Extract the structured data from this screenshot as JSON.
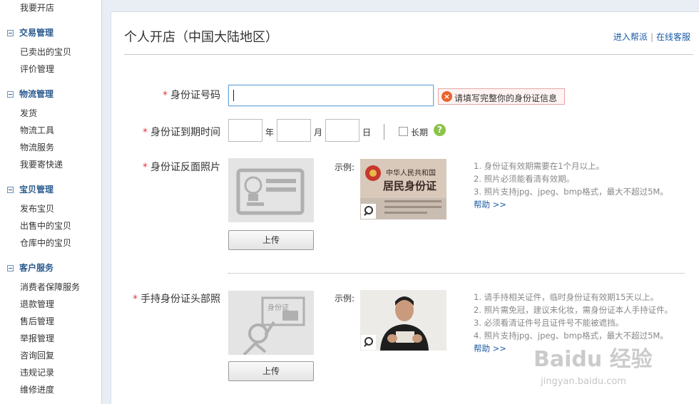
{
  "sidebar": {
    "top_item": "我要开店",
    "sections": [
      {
        "title": "交易管理",
        "items": [
          "已卖出的宝贝",
          "评价管理"
        ]
      },
      {
        "title": "物流管理",
        "items": [
          "发货",
          "物流工具",
          "物流服务",
          "我要寄快递"
        ]
      },
      {
        "title": "宝贝管理",
        "items": [
          "发布宝贝",
          "出售中的宝贝",
          "仓库中的宝贝"
        ]
      },
      {
        "title": "客户服务",
        "items": [
          "消费者保障服务",
          "退款管理",
          "售后管理",
          "举报管理",
          "咨询回复",
          "违规记录",
          "维修进度"
        ]
      }
    ]
  },
  "header": {
    "title": "个人开店（中国大陆地区）",
    "link_help": "进入帮派",
    "link_sep": "|",
    "link_service": "在线客服"
  },
  "form": {
    "required_mark": "*",
    "id_number": {
      "label": "身份证号码",
      "value": "",
      "error": "请填写完整你的身份证信息"
    },
    "expiry": {
      "label": "身份证到期时间",
      "year_unit": "年",
      "month_unit": "月",
      "day_unit": "日",
      "long_term_label": "长期",
      "help_icon": "?"
    },
    "back_photo": {
      "label": "身份证反面照片",
      "upload_label": "上传",
      "example_label": "示例:",
      "sample_title": "中华人民共和国",
      "sample_subtitle": "居民身份证",
      "tips": [
        "1. 身份证有效期需要在1个月以上。",
        "2. 照片必须能看清有效期。",
        "3. 照片支持jpg、jpeg、bmp格式，最大不超过5M。"
      ],
      "help_link": "帮助 >>"
    },
    "hold_photo": {
      "label": "手持身份证头部照",
      "card_text": "身份证",
      "upload_label": "上传",
      "example_label": "示例:",
      "tips": [
        "1. 请手持相关证件，临时身份证有效期15天以上。",
        "2. 照片需免冠，建议未化妆，需身份证本人手持证件。",
        "3. 必须看清证件号且证件号不能被遮挡。",
        "4. 照片支持jpg、jpeg、bmp格式，最大不超过5M。"
      ],
      "help_link": "帮助 >>"
    }
  },
  "watermark": {
    "brand": "Baidu 经验",
    "url": "jingyan.baidu.com"
  },
  "colors": {
    "accent": "#1b5aa6",
    "error": "#e8622b",
    "required": "#e4393c"
  }
}
